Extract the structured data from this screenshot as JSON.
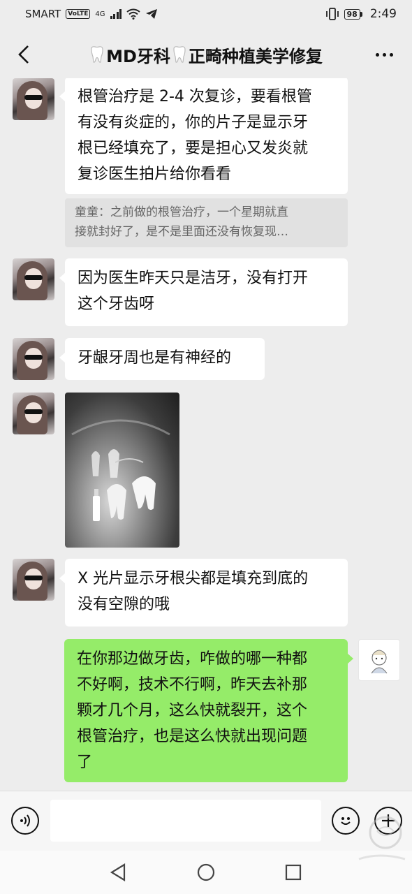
{
  "status_bar": {
    "carrier": "SMART",
    "volte": "VoLTE",
    "network": "4G",
    "battery": "98",
    "time": "2:49"
  },
  "header": {
    "title_left": "MD牙科",
    "title_right": "正畸种植美学修复",
    "back_icon": "chevron-left-icon",
    "more_icon": "more-dots-icon"
  },
  "messages": [
    {
      "from": "other",
      "type": "text",
      "lines": [
        "根管治疗是 2-4 次复诊，要看根管",
        "有没有炎症的，你的片子是显示牙",
        "根已经填充了，要是担心又发炎就",
        "复诊医生拍片给你看看"
      ]
    },
    {
      "from": "quote",
      "type": "quote",
      "lines": [
        "童童：之前做的根管治疗，一个星期就直",
        "接就封好了，是不是里面还没有恢复现…"
      ]
    },
    {
      "from": "other",
      "type": "text",
      "lines": [
        "因为医生昨天只是洁牙，没有打开",
        "这个牙齿呀"
      ]
    },
    {
      "from": "other",
      "type": "text",
      "lines": [
        "牙龈牙周也是有神经的"
      ]
    },
    {
      "from": "other",
      "type": "image",
      "image_desc": "dental-xray"
    },
    {
      "from": "other",
      "type": "text",
      "lines": [
        "X 光片显示牙根尖都是填充到底的",
        "没有空隙的哦"
      ]
    },
    {
      "from": "self",
      "type": "text",
      "lines": [
        "在你那边做牙齿，咋做的哪一种都",
        "不好啊，技术不行啊，昨天去补那",
        "颗才几个月，这么快就裂开，这个",
        "根管治疗，也是这么快就出现问题",
        "了"
      ]
    }
  ],
  "input_bar": {
    "voice_icon": "voice-icon",
    "emoji_icon": "emoji-icon",
    "plus_icon": "plus-icon",
    "placeholder": ""
  },
  "colors": {
    "background": "#ededed",
    "self_bubble": "#95ec69",
    "other_bubble": "#ffffff",
    "quote_bg": "#e1e1e1"
  }
}
